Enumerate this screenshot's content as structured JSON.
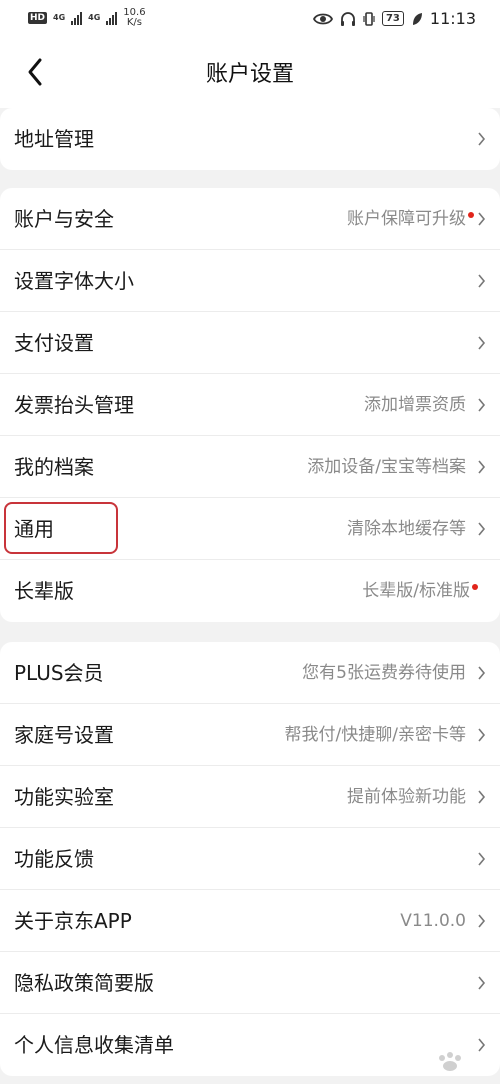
{
  "status_bar": {
    "hd_badge": "HD",
    "net1": "4G",
    "net2": "4G",
    "speed_value": "10.6",
    "speed_unit": "K/s",
    "battery": "73",
    "time": "11:13",
    "icons": [
      "eye-icon",
      "headphones-icon",
      "vibrate-icon",
      "battery-icon",
      "leaf-icon"
    ]
  },
  "header": {
    "title": "账户设置",
    "back_icon": "chevron-left-icon"
  },
  "groups": [
    {
      "items": [
        {
          "label": "地址管理",
          "value": "",
          "dot": false
        }
      ]
    },
    {
      "items": [
        {
          "label": "账户与安全",
          "value": "账户保障可升级",
          "dot": true
        },
        {
          "label": "设置字体大小",
          "value": "",
          "dot": false
        },
        {
          "label": "支付设置",
          "value": "",
          "dot": false
        },
        {
          "label": "发票抬头管理",
          "value": "添加增票资质",
          "dot": false
        },
        {
          "label": "我的档案",
          "value": "添加设备/宝宝等档案",
          "dot": false
        },
        {
          "label": "通用",
          "value": "清除本地缓存等",
          "dot": false,
          "highlighted": true
        },
        {
          "label": "长辈版",
          "value": "长辈版/标准版",
          "dot": true,
          "no_chevron": true
        }
      ]
    },
    {
      "items": [
        {
          "label": "PLUS会员",
          "value": "您有5张运费券待使用",
          "dot": false
        },
        {
          "label": "家庭号设置",
          "value": "帮我付/快捷聊/亲密卡等",
          "dot": false
        },
        {
          "label": "功能实验室",
          "value": "提前体验新功能",
          "dot": false
        },
        {
          "label": "功能反馈",
          "value": "",
          "dot": false
        },
        {
          "label": "关于京东APP",
          "value": "V11.0.0",
          "dot": false
        },
        {
          "label": "隐私政策简要版",
          "value": "",
          "dot": false
        },
        {
          "label": "个人信息收集清单",
          "value": "",
          "dot": false
        }
      ]
    }
  ],
  "colors": {
    "accent_red": "#e1251b",
    "highlight_border": "#c8343a",
    "background": "#f2f2f2"
  }
}
